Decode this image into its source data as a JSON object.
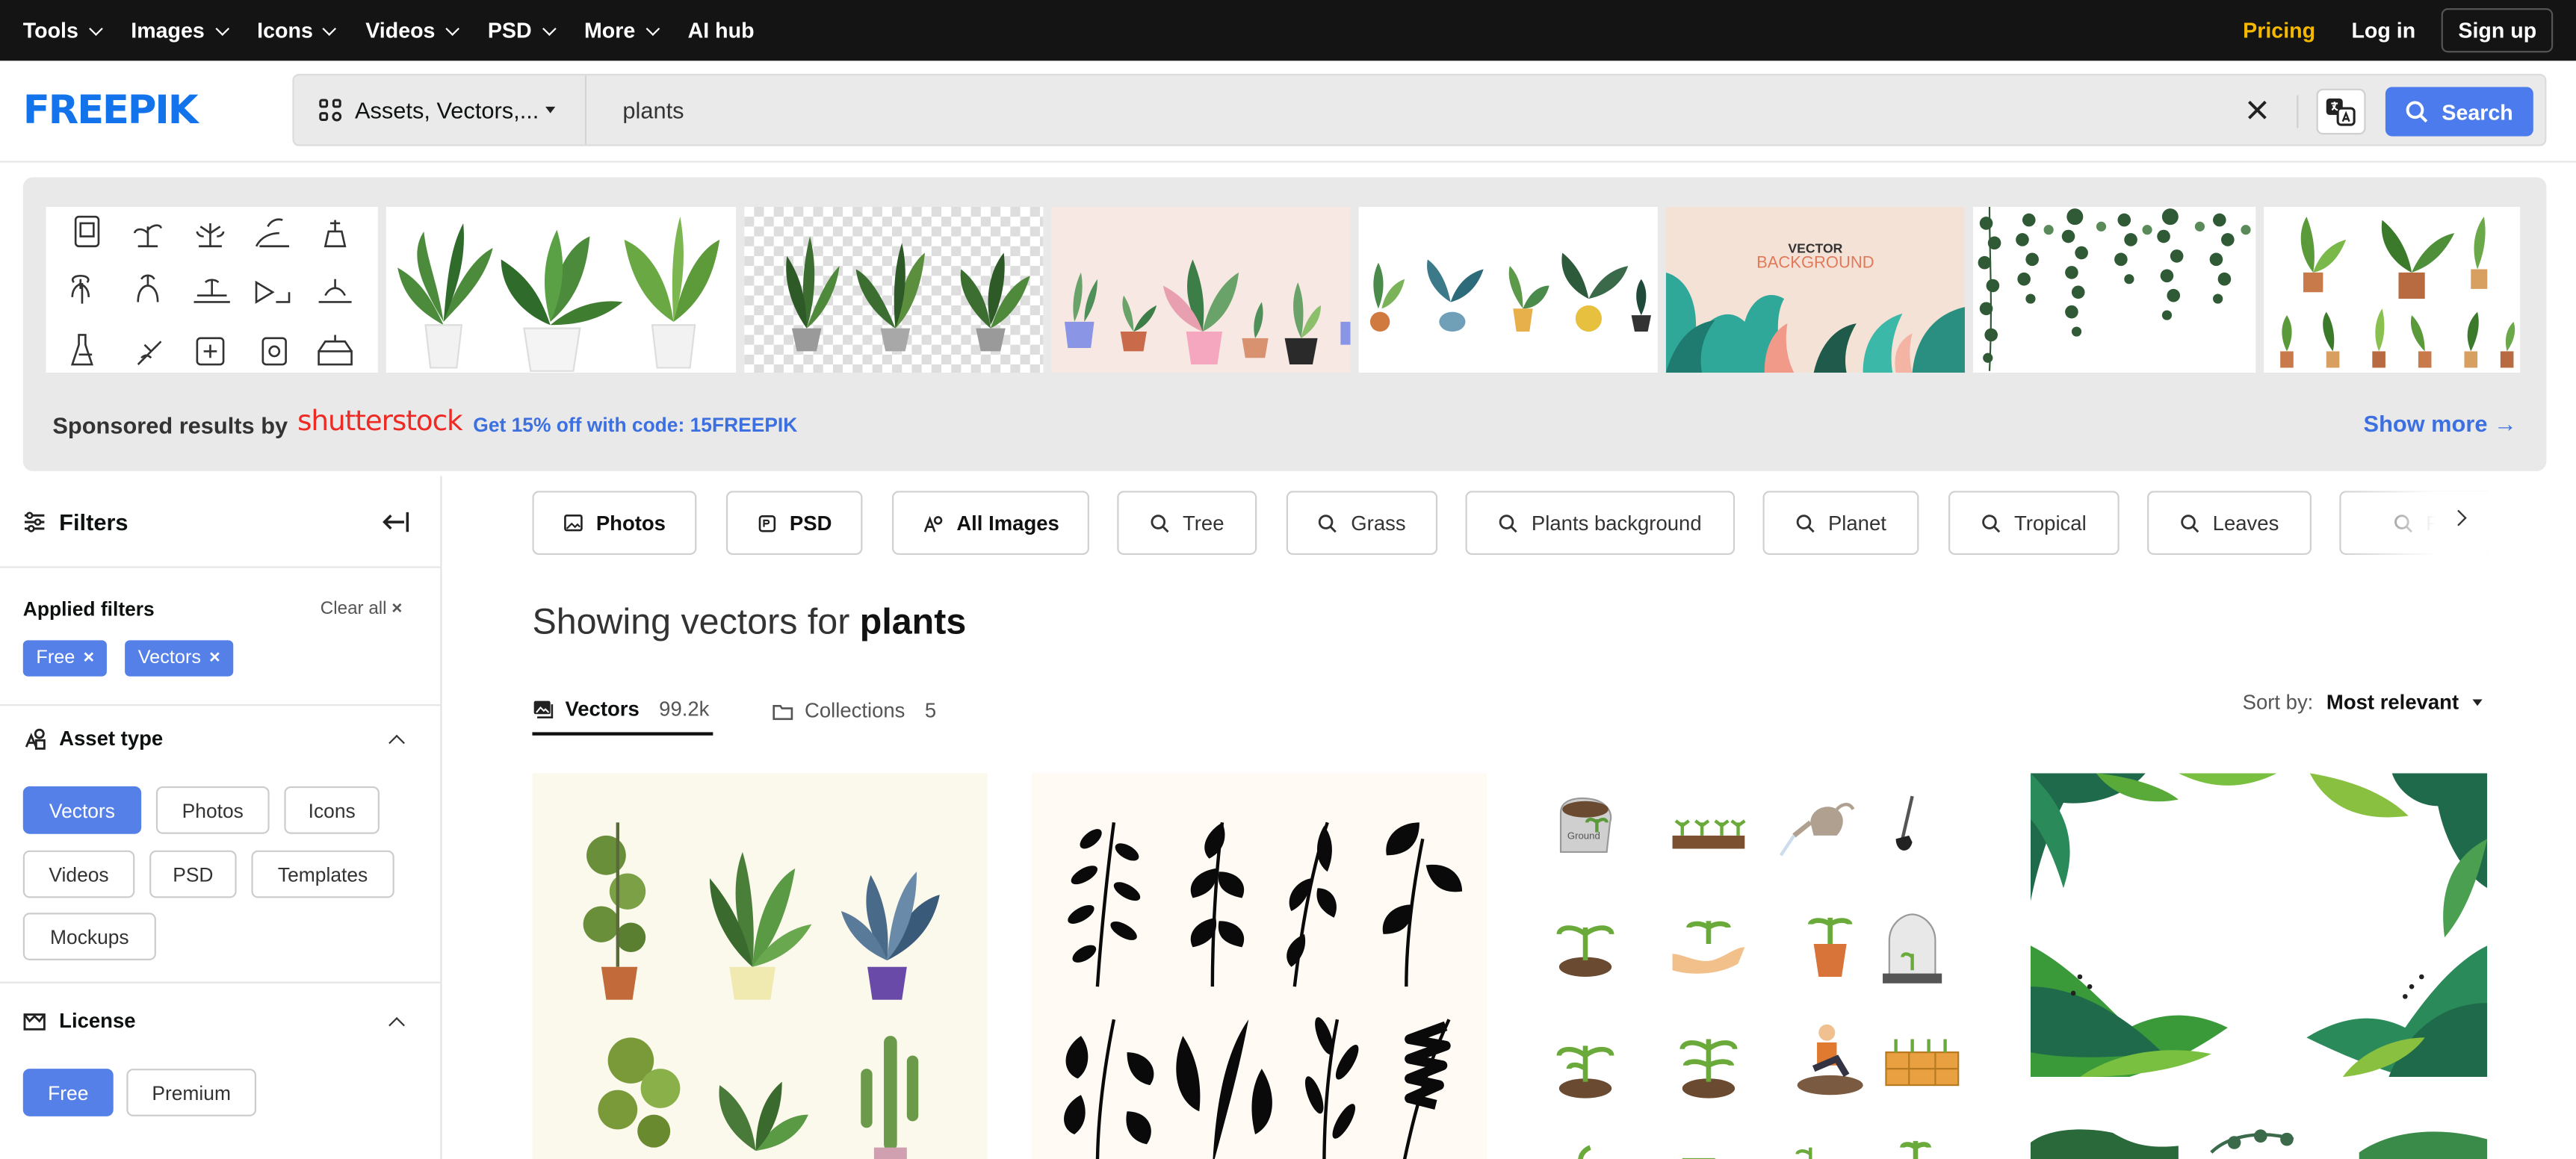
{
  "topnav": {
    "items": [
      {
        "label": "Tools",
        "dropdown": true
      },
      {
        "label": "Images",
        "dropdown": true
      },
      {
        "label": "Icons",
        "dropdown": true
      },
      {
        "label": "Videos",
        "dropdown": true
      },
      {
        "label": "PSD",
        "dropdown": true
      },
      {
        "label": "More",
        "dropdown": true
      },
      {
        "label": "AI hub",
        "dropdown": false
      }
    ],
    "pricing": "Pricing",
    "login": "Log in",
    "signup": "Sign up"
  },
  "brand": {
    "logo_text": "FREEPIK",
    "color": "#1273eb"
  },
  "search": {
    "asset_selector": "Assets, Vectors,...",
    "query": "plants",
    "button_label": "Search"
  },
  "sponsored": {
    "label": "Sponsored results by",
    "provider_logo": "shutterstock",
    "promo": "Get 15% off with code: 15FREEPIK",
    "show_more": "Show more",
    "banner_text": "VECTOR BACKGROUND"
  },
  "sidebar": {
    "title": "Filters",
    "applied_label": "Applied filters",
    "clear_all": "Clear all",
    "applied_chips": [
      "Free",
      "Vectors"
    ],
    "asset_type": {
      "label": "Asset type",
      "options": [
        "Vectors",
        "Photos",
        "Icons",
        "Videos",
        "PSD",
        "Templates",
        "Mockups"
      ],
      "selected": "Vectors"
    },
    "license": {
      "label": "License",
      "options": [
        "Free",
        "Premium"
      ],
      "selected": "Free"
    }
  },
  "related": [
    "Photos",
    "PSD",
    "All Images",
    "Tree",
    "Grass",
    "Plants background",
    "Planet",
    "Tropical",
    "Leaves",
    "Fo"
  ],
  "results": {
    "heading_prefix": "Showing vectors for",
    "query": "plants",
    "tabs": [
      {
        "label": "Vectors",
        "count": "99.2k",
        "active": true
      },
      {
        "label": "Collections",
        "count": "5",
        "active": false
      }
    ],
    "sort_label": "Sort by:",
    "sort_value": "Most relevant",
    "sack_label": "Ground"
  },
  "colors": {
    "accent": "#4b7bec",
    "pricing": "#f5b800",
    "promo": "#3c6fe0",
    "nav_bg": "#141414"
  }
}
